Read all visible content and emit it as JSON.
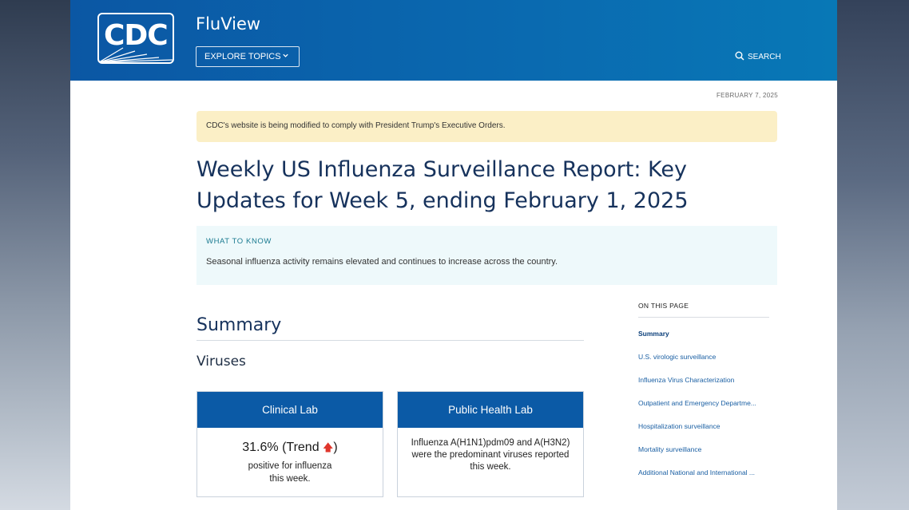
{
  "header": {
    "logo_text": "CDC",
    "site_title": "FluView",
    "explore_label": "EXPLORE TOPICS",
    "search_label": "SEARCH"
  },
  "date": "FEBRUARY 7, 2025",
  "alert": "CDC's website is being modified to comply with President Trump's Executive Orders.",
  "title": {
    "line1": "Weekly US Influenza Surveillance Report: Key",
    "line2": "Updates for Week 5, ending February 1, 2025"
  },
  "what_to_know": {
    "heading": "WHAT TO KNOW",
    "body": "Seasonal influenza activity remains elevated and continues to increase across the country."
  },
  "summary": {
    "heading": "Summary",
    "subheading": "Viruses"
  },
  "cards": [
    {
      "title": "Clinical Lab",
      "value": "31.6% (Trend ",
      "arrow": "🡅",
      "value_end": ")",
      "line1": "positive for influenza",
      "line2": "this week."
    },
    {
      "title": "Public Health Lab",
      "line1": "Influenza A(H1N1)pdm09 and A(H3N2)",
      "line2": "were the predominant viruses reported",
      "line3": "this week."
    }
  ],
  "on_this_page": {
    "heading": "ON THIS PAGE",
    "items": [
      "Summary",
      "U.S. virologic surveillance",
      "Influenza Virus Characterization",
      "Outpatient and Emergency Departme...",
      "Hospitalization surveillance",
      "Mortality surveillance",
      "Additional National and International ..."
    ]
  },
  "colors": {
    "header_blue": "#0b57a4",
    "card_header_blue": "#0b5aa6",
    "alert_yellow": "#fbefc6",
    "title_navy": "#16325c",
    "trend_up_red": "#e0362c"
  }
}
